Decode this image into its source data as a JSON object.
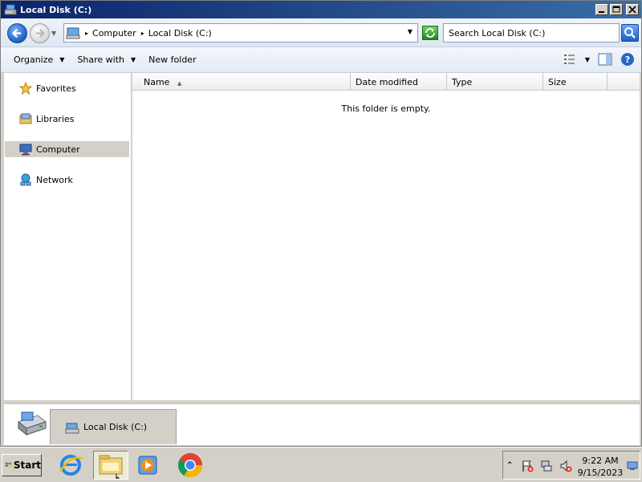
{
  "window": {
    "title": "Local Disk (C:)"
  },
  "address": {
    "crumbs": [
      "Computer",
      "Local Disk (C:)"
    ]
  },
  "search": {
    "placeholder": "Search Local Disk (C:)"
  },
  "toolbar": {
    "organize": "Organize",
    "share_with": "Share with",
    "new_folder": "New folder"
  },
  "navpane": {
    "items": [
      {
        "label": "Favorites",
        "icon": "star-icon"
      },
      {
        "label": "Libraries",
        "icon": "libraries-icon"
      },
      {
        "label": "Computer",
        "icon": "computer-icon",
        "selected": true
      },
      {
        "label": "Network",
        "icon": "network-icon"
      }
    ]
  },
  "filelist": {
    "columns": [
      "Name",
      "Date modified",
      "Type",
      "Size"
    ],
    "sort_column": "Name",
    "empty_message": "This folder is empty."
  },
  "details": {
    "tab_label": "Local Disk (C:)"
  },
  "taskbar": {
    "start_label": "Start",
    "pinned": [
      "internet-explorer-icon",
      "file-explorer-icon",
      "media-player-icon",
      "chrome-icon"
    ],
    "clock_time": "9:22 AM",
    "clock_date": "9/15/2023"
  },
  "colors": {
    "title_gradient_start": "#0a246a",
    "title_gradient_end": "#3a6ea5",
    "classic_gray": "#d4d0c8",
    "selection_gray": "#d4d0c8"
  }
}
